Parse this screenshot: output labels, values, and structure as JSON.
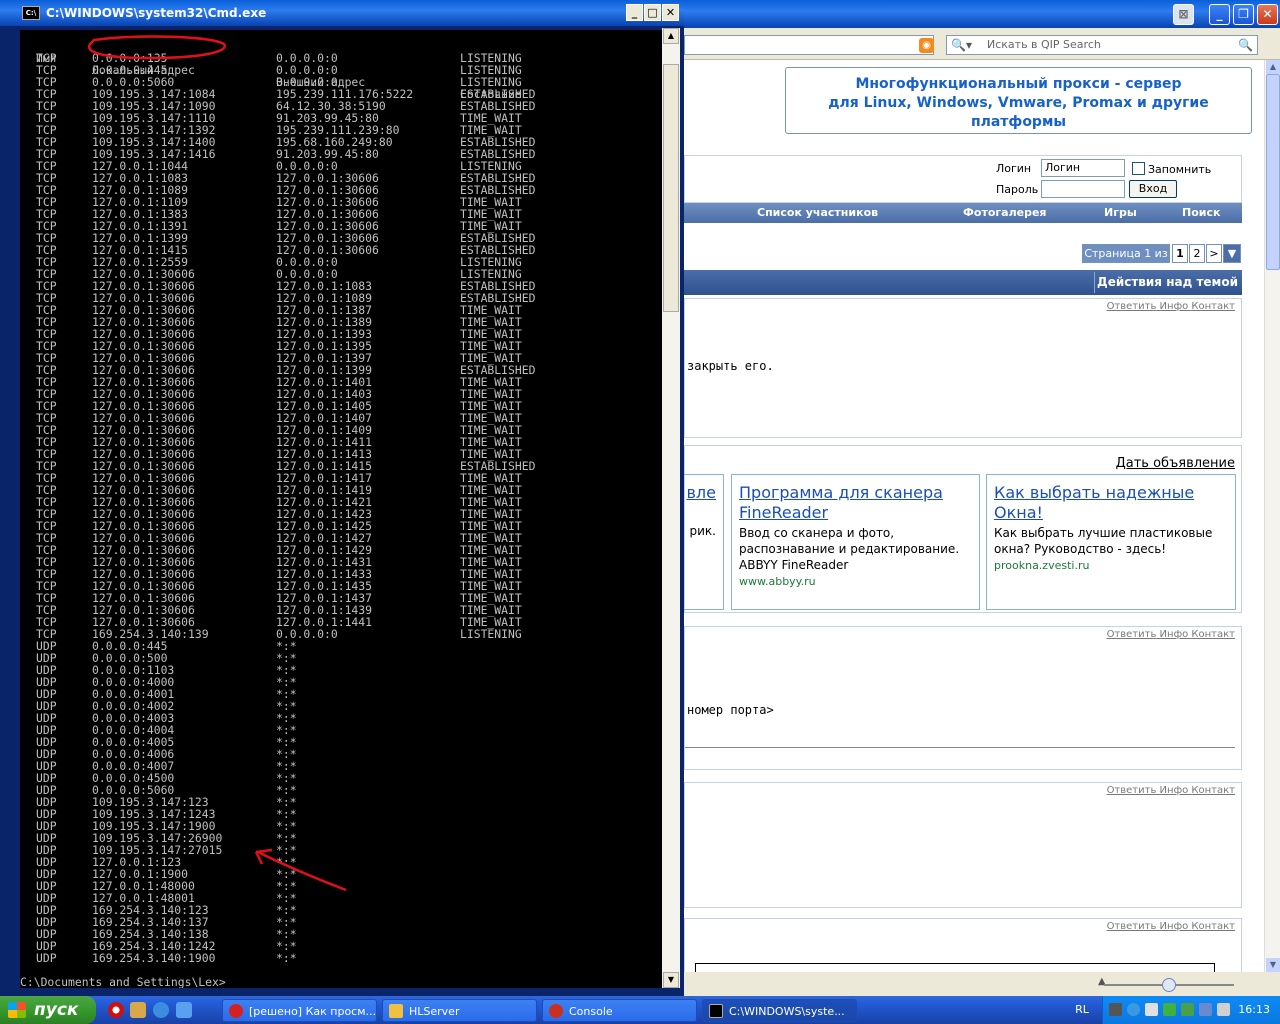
{
  "browser": {
    "search_placeholder": "Искать в QIP Search",
    "banner_line1": "Многофункциональный прокси - сервер",
    "banner_line2": "для Linux, Windows, Vmware, Promax и другие платформы",
    "login": {
      "login_label": "Логин",
      "login_value": "Логин",
      "remember_label": "Запомнить меня",
      "password_label": "Пароль",
      "submit_label": "Вход"
    },
    "nav": [
      "Список участников",
      "Фотогалерея",
      "Игры",
      "Поиск"
    ],
    "pager": {
      "label": "Страница 1 из 2",
      "pages": [
        "1",
        "2",
        ">",
        "▼"
      ]
    },
    "topic_actions": "Действия над темой",
    "post_actions": [
      "Ответить",
      "Инфо",
      "Контакт"
    ],
    "post1_text": "закрыть его.",
    "post2_text": "номер порта>",
    "ads": {
      "header_link": "Дать объявление",
      "partial_title": "вле",
      "partial_text": "рик.",
      "items": [
        {
          "title": "Программа для сканера FineReader",
          "text": "Ввод со сканера и фото, распознавание и редактирование. ABBYY FineReader",
          "url": "www.abbyy.ru"
        },
        {
          "title": "Как выбрать надежные Окна!",
          "text": "Как выбрать лучшие пластиковые окна? Руководство - здесь!",
          "url": "prookna.zvesti.ru"
        }
      ]
    }
  },
  "cmd": {
    "title": "C:\\WINDOWS\\system32\\Cmd.exe",
    "headers": [
      "Имя",
      "Локальный адрес",
      "Внешний адрес",
      "Состояние"
    ],
    "rows": [
      [
        "TCP",
        "0.0.0.0:135",
        "0.0.0.0:0",
        "LISTENING"
      ],
      [
        "TCP",
        "0.0.0.0:445",
        "0.0.0.0:0",
        "LISTENING"
      ],
      [
        "TCP",
        "0.0.0.0:5060",
        "0.0.0.0:0",
        "LISTENING"
      ],
      [
        "TCP",
        "109.195.3.147:1084",
        "195.239.111.176:5222",
        "ESTABLISHED"
      ],
      [
        "TCP",
        "109.195.3.147:1090",
        "64.12.30.38:5190",
        "ESTABLISHED"
      ],
      [
        "TCP",
        "109.195.3.147:1110",
        "91.203.99.45:80",
        "TIME_WAIT"
      ],
      [
        "TCP",
        "109.195.3.147:1392",
        "195.239.111.239:80",
        "TIME_WAIT"
      ],
      [
        "TCP",
        "109.195.3.147:1400",
        "195.68.160.249:80",
        "ESTABLISHED"
      ],
      [
        "TCP",
        "109.195.3.147:1416",
        "91.203.99.45:80",
        "ESTABLISHED"
      ],
      [
        "TCP",
        "127.0.0.1:1044",
        "0.0.0.0:0",
        "LISTENING"
      ],
      [
        "TCP",
        "127.0.0.1:1083",
        "127.0.0.1:30606",
        "ESTABLISHED"
      ],
      [
        "TCP",
        "127.0.0.1:1089",
        "127.0.0.1:30606",
        "ESTABLISHED"
      ],
      [
        "TCP",
        "127.0.0.1:1109",
        "127.0.0.1:30606",
        "TIME_WAIT"
      ],
      [
        "TCP",
        "127.0.0.1:1383",
        "127.0.0.1:30606",
        "TIME_WAIT"
      ],
      [
        "TCP",
        "127.0.0.1:1391",
        "127.0.0.1:30606",
        "TIME_WAIT"
      ],
      [
        "TCP",
        "127.0.0.1:1399",
        "127.0.0.1:30606",
        "ESTABLISHED"
      ],
      [
        "TCP",
        "127.0.0.1:1415",
        "127.0.0.1:30606",
        "ESTABLISHED"
      ],
      [
        "TCP",
        "127.0.0.1:2559",
        "0.0.0.0:0",
        "LISTENING"
      ],
      [
        "TCP",
        "127.0.0.1:30606",
        "0.0.0.0:0",
        "LISTENING"
      ],
      [
        "TCP",
        "127.0.0.1:30606",
        "127.0.0.1:1083",
        "ESTABLISHED"
      ],
      [
        "TCP",
        "127.0.0.1:30606",
        "127.0.0.1:1089",
        "ESTABLISHED"
      ],
      [
        "TCP",
        "127.0.0.1:30606",
        "127.0.0.1:1387",
        "TIME_WAIT"
      ],
      [
        "TCP",
        "127.0.0.1:30606",
        "127.0.0.1:1389",
        "TIME_WAIT"
      ],
      [
        "TCP",
        "127.0.0.1:30606",
        "127.0.0.1:1393",
        "TIME_WAIT"
      ],
      [
        "TCP",
        "127.0.0.1:30606",
        "127.0.0.1:1395",
        "TIME_WAIT"
      ],
      [
        "TCP",
        "127.0.0.1:30606",
        "127.0.0.1:1397",
        "TIME_WAIT"
      ],
      [
        "TCP",
        "127.0.0.1:30606",
        "127.0.0.1:1399",
        "ESTABLISHED"
      ],
      [
        "TCP",
        "127.0.0.1:30606",
        "127.0.0.1:1401",
        "TIME_WAIT"
      ],
      [
        "TCP",
        "127.0.0.1:30606",
        "127.0.0.1:1403",
        "TIME_WAIT"
      ],
      [
        "TCP",
        "127.0.0.1:30606",
        "127.0.0.1:1405",
        "TIME_WAIT"
      ],
      [
        "TCP",
        "127.0.0.1:30606",
        "127.0.0.1:1407",
        "TIME_WAIT"
      ],
      [
        "TCP",
        "127.0.0.1:30606",
        "127.0.0.1:1409",
        "TIME_WAIT"
      ],
      [
        "TCP",
        "127.0.0.1:30606",
        "127.0.0.1:1411",
        "TIME_WAIT"
      ],
      [
        "TCP",
        "127.0.0.1:30606",
        "127.0.0.1:1413",
        "TIME_WAIT"
      ],
      [
        "TCP",
        "127.0.0.1:30606",
        "127.0.0.1:1415",
        "ESTABLISHED"
      ],
      [
        "TCP",
        "127.0.0.1:30606",
        "127.0.0.1:1417",
        "TIME_WAIT"
      ],
      [
        "TCP",
        "127.0.0.1:30606",
        "127.0.0.1:1419",
        "TIME_WAIT"
      ],
      [
        "TCP",
        "127.0.0.1:30606",
        "127.0.0.1:1421",
        "TIME_WAIT"
      ],
      [
        "TCP",
        "127.0.0.1:30606",
        "127.0.0.1:1423",
        "TIME_WAIT"
      ],
      [
        "TCP",
        "127.0.0.1:30606",
        "127.0.0.1:1425",
        "TIME_WAIT"
      ],
      [
        "TCP",
        "127.0.0.1:30606",
        "127.0.0.1:1427",
        "TIME_WAIT"
      ],
      [
        "TCP",
        "127.0.0.1:30606",
        "127.0.0.1:1429",
        "TIME_WAIT"
      ],
      [
        "TCP",
        "127.0.0.1:30606",
        "127.0.0.1:1431",
        "TIME_WAIT"
      ],
      [
        "TCP",
        "127.0.0.1:30606",
        "127.0.0.1:1433",
        "TIME_WAIT"
      ],
      [
        "TCP",
        "127.0.0.1:30606",
        "127.0.0.1:1435",
        "TIME_WAIT"
      ],
      [
        "TCP",
        "127.0.0.1:30606",
        "127.0.0.1:1437",
        "TIME_WAIT"
      ],
      [
        "TCP",
        "127.0.0.1:30606",
        "127.0.0.1:1439",
        "TIME_WAIT"
      ],
      [
        "TCP",
        "127.0.0.1:30606",
        "127.0.0.1:1441",
        "TIME_WAIT"
      ],
      [
        "TCP",
        "169.254.3.140:139",
        "0.0.0.0:0",
        "LISTENING"
      ],
      [
        "UDP",
        "0.0.0.0:445",
        "*:*",
        ""
      ],
      [
        "UDP",
        "0.0.0.0:500",
        "*:*",
        ""
      ],
      [
        "UDP",
        "0.0.0.0:1103",
        "*:*",
        ""
      ],
      [
        "UDP",
        "0.0.0.0:4000",
        "*:*",
        ""
      ],
      [
        "UDP",
        "0.0.0.0:4001",
        "*:*",
        ""
      ],
      [
        "UDP",
        "0.0.0.0:4002",
        "*:*",
        ""
      ],
      [
        "UDP",
        "0.0.0.0:4003",
        "*:*",
        ""
      ],
      [
        "UDP",
        "0.0.0.0:4004",
        "*:*",
        ""
      ],
      [
        "UDP",
        "0.0.0.0:4005",
        "*:*",
        ""
      ],
      [
        "UDP",
        "0.0.0.0:4006",
        "*:*",
        ""
      ],
      [
        "UDP",
        "0.0.0.0:4007",
        "*:*",
        ""
      ],
      [
        "UDP",
        "0.0.0.0:4500",
        "*:*",
        ""
      ],
      [
        "UDP",
        "0.0.0.0:5060",
        "*:*",
        ""
      ],
      [
        "UDP",
        "109.195.3.147:123",
        "*:*",
        ""
      ],
      [
        "UDP",
        "109.195.3.147:1243",
        "*:*",
        ""
      ],
      [
        "UDP",
        "109.195.3.147:1900",
        "*:*",
        ""
      ],
      [
        "UDP",
        "109.195.3.147:26900",
        "*:*",
        ""
      ],
      [
        "UDP",
        "109.195.3.147:27015",
        "*:*",
        ""
      ],
      [
        "UDP",
        "127.0.0.1:123",
        "*:*",
        ""
      ],
      [
        "UDP",
        "127.0.0.1:1900",
        "*:*",
        ""
      ],
      [
        "UDP",
        "127.0.0.1:48000",
        "*:*",
        ""
      ],
      [
        "UDP",
        "127.0.0.1:48001",
        "*:*",
        ""
      ],
      [
        "UDP",
        "169.254.3.140:123",
        "*:*",
        ""
      ],
      [
        "UDP",
        "169.254.3.140:137",
        "*:*",
        ""
      ],
      [
        "UDP",
        "169.254.3.140:138",
        "*:*",
        ""
      ],
      [
        "UDP",
        "169.254.3.140:1242",
        "*:*",
        ""
      ],
      [
        "UDP",
        "169.254.3.140:1900",
        "*:*",
        ""
      ]
    ],
    "prompt": "C:\\Documents and Settings\\Lex>"
  },
  "taskbar": {
    "start_label": "пуск",
    "tasks": [
      {
        "label": "[решено] Как просм...",
        "icon_color": "#d42020"
      },
      {
        "label": "HLServer",
        "icon_color": "#f0c040"
      },
      {
        "label": "Console",
        "icon_color": "#c83020"
      },
      {
        "label": "C:\\WINDOWS\\syste...",
        "icon_color": "#000000"
      }
    ],
    "lang": "RL",
    "clock": "16:13"
  },
  "colors": {
    "annotation_red": "#e0101a",
    "cmd_text": "#c0c0c0",
    "xp_blue": "#245edb"
  }
}
